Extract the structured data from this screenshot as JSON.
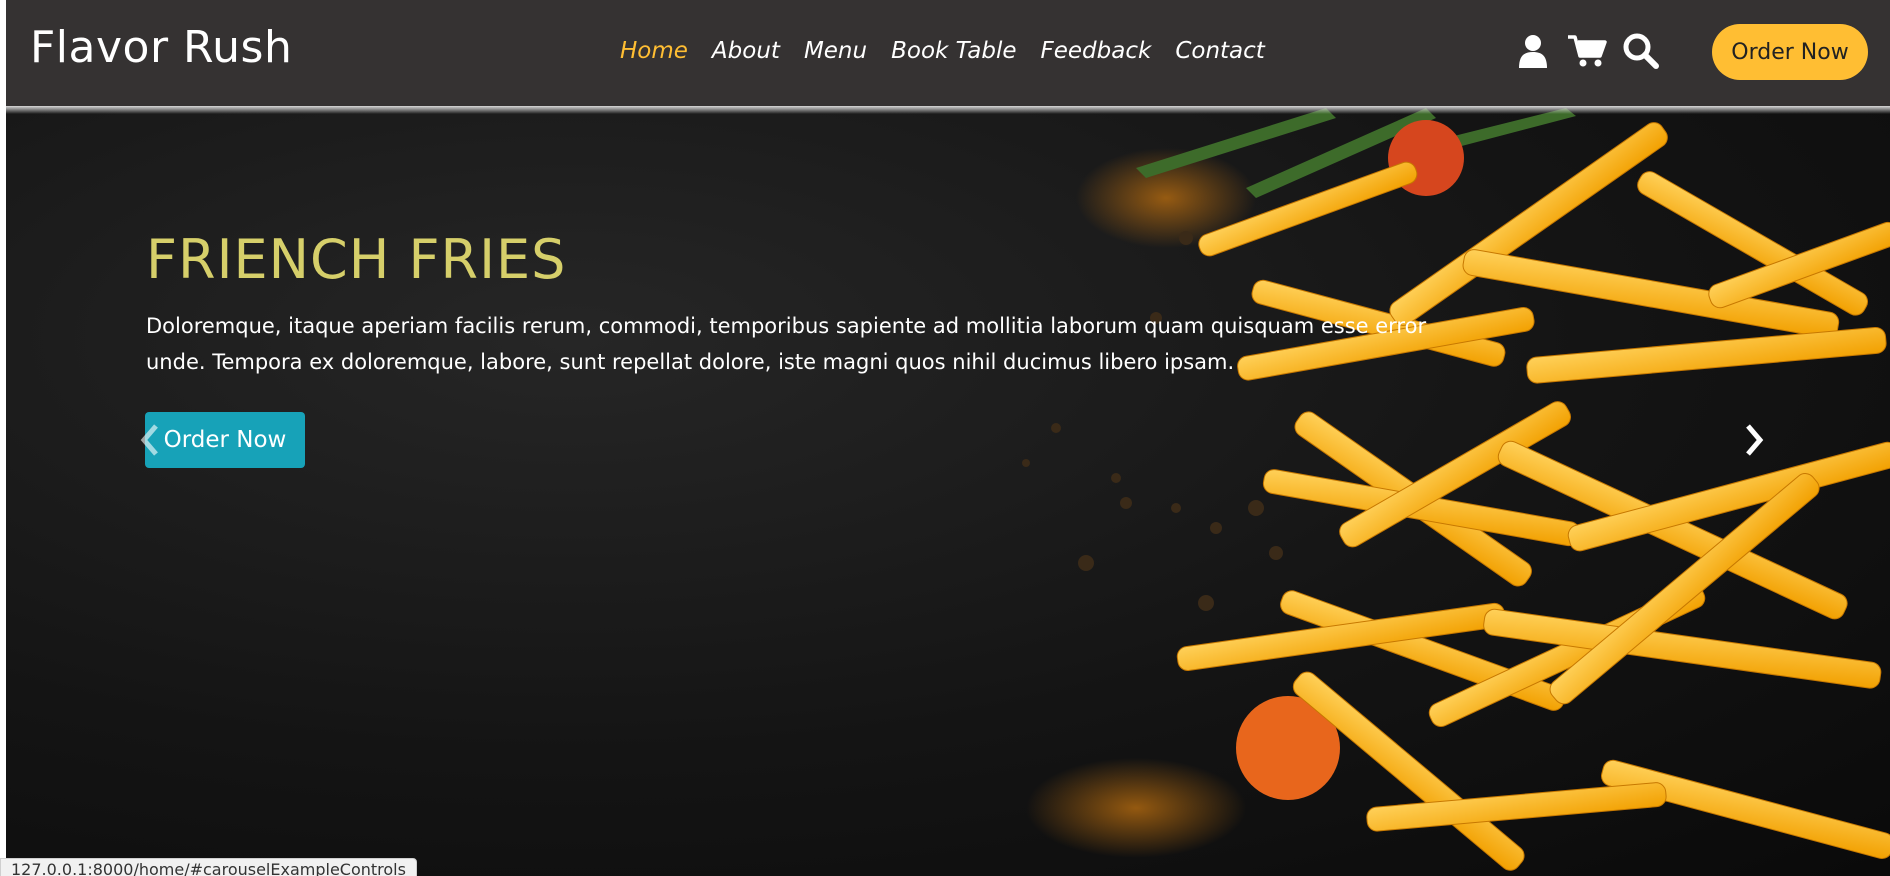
{
  "navbar": {
    "brand": "Flavor Rush",
    "links": [
      {
        "label": "Home",
        "active": true
      },
      {
        "label": "About"
      },
      {
        "label": "Menu"
      },
      {
        "label": "Book Table"
      },
      {
        "label": "Feedback"
      },
      {
        "label": "Contact"
      }
    ],
    "icons": [
      "user-icon",
      "cart-icon",
      "search-icon"
    ],
    "order_button": "Order Now",
    "accent_color": "#ffbe33",
    "background_color": "#353232"
  },
  "hero": {
    "title": "FRIENCH FRIES",
    "description": "Doloremque, itaque aperiam facilis rerum, commodi, temporibus sapiente ad mollitia laborum quam quisquam esse error unde. Tempora ex doloremque, labore, sunt repellat dolore, iste magni quos nihil ducimus libero ipsam.",
    "button": "Order Now",
    "button_color": "#17a2b8",
    "title_color": "#d6cf6a"
  },
  "status_bar": {
    "url": "127.0.0.1:8000/home/#carouselExampleControls"
  }
}
